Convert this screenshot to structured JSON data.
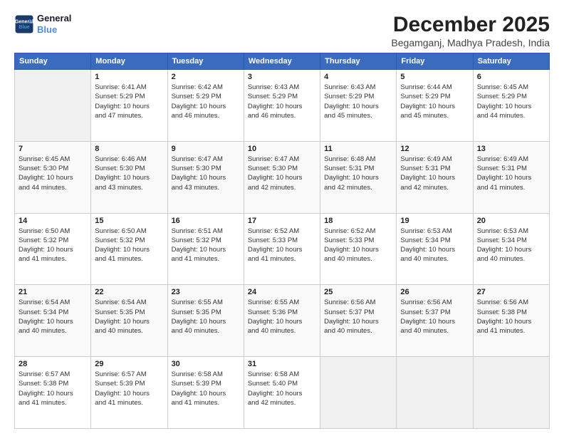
{
  "header": {
    "logo_line1": "General",
    "logo_line2": "Blue",
    "month": "December 2025",
    "location": "Begamganj, Madhya Pradesh, India"
  },
  "weekdays": [
    "Sunday",
    "Monday",
    "Tuesday",
    "Wednesday",
    "Thursday",
    "Friday",
    "Saturday"
  ],
  "weeks": [
    [
      {
        "day": "",
        "info": ""
      },
      {
        "day": "1",
        "info": "Sunrise: 6:41 AM\nSunset: 5:29 PM\nDaylight: 10 hours\nand 47 minutes."
      },
      {
        "day": "2",
        "info": "Sunrise: 6:42 AM\nSunset: 5:29 PM\nDaylight: 10 hours\nand 46 minutes."
      },
      {
        "day": "3",
        "info": "Sunrise: 6:43 AM\nSunset: 5:29 PM\nDaylight: 10 hours\nand 46 minutes."
      },
      {
        "day": "4",
        "info": "Sunrise: 6:43 AM\nSunset: 5:29 PM\nDaylight: 10 hours\nand 45 minutes."
      },
      {
        "day": "5",
        "info": "Sunrise: 6:44 AM\nSunset: 5:29 PM\nDaylight: 10 hours\nand 45 minutes."
      },
      {
        "day": "6",
        "info": "Sunrise: 6:45 AM\nSunset: 5:29 PM\nDaylight: 10 hours\nand 44 minutes."
      }
    ],
    [
      {
        "day": "7",
        "info": "Sunrise: 6:45 AM\nSunset: 5:30 PM\nDaylight: 10 hours\nand 44 minutes."
      },
      {
        "day": "8",
        "info": "Sunrise: 6:46 AM\nSunset: 5:30 PM\nDaylight: 10 hours\nand 43 minutes."
      },
      {
        "day": "9",
        "info": "Sunrise: 6:47 AM\nSunset: 5:30 PM\nDaylight: 10 hours\nand 43 minutes."
      },
      {
        "day": "10",
        "info": "Sunrise: 6:47 AM\nSunset: 5:30 PM\nDaylight: 10 hours\nand 42 minutes."
      },
      {
        "day": "11",
        "info": "Sunrise: 6:48 AM\nSunset: 5:31 PM\nDaylight: 10 hours\nand 42 minutes."
      },
      {
        "day": "12",
        "info": "Sunrise: 6:49 AM\nSunset: 5:31 PM\nDaylight: 10 hours\nand 42 minutes."
      },
      {
        "day": "13",
        "info": "Sunrise: 6:49 AM\nSunset: 5:31 PM\nDaylight: 10 hours\nand 41 minutes."
      }
    ],
    [
      {
        "day": "14",
        "info": "Sunrise: 6:50 AM\nSunset: 5:32 PM\nDaylight: 10 hours\nand 41 minutes."
      },
      {
        "day": "15",
        "info": "Sunrise: 6:50 AM\nSunset: 5:32 PM\nDaylight: 10 hours\nand 41 minutes."
      },
      {
        "day": "16",
        "info": "Sunrise: 6:51 AM\nSunset: 5:32 PM\nDaylight: 10 hours\nand 41 minutes."
      },
      {
        "day": "17",
        "info": "Sunrise: 6:52 AM\nSunset: 5:33 PM\nDaylight: 10 hours\nand 41 minutes."
      },
      {
        "day": "18",
        "info": "Sunrise: 6:52 AM\nSunset: 5:33 PM\nDaylight: 10 hours\nand 40 minutes."
      },
      {
        "day": "19",
        "info": "Sunrise: 6:53 AM\nSunset: 5:34 PM\nDaylight: 10 hours\nand 40 minutes."
      },
      {
        "day": "20",
        "info": "Sunrise: 6:53 AM\nSunset: 5:34 PM\nDaylight: 10 hours\nand 40 minutes."
      }
    ],
    [
      {
        "day": "21",
        "info": "Sunrise: 6:54 AM\nSunset: 5:34 PM\nDaylight: 10 hours\nand 40 minutes."
      },
      {
        "day": "22",
        "info": "Sunrise: 6:54 AM\nSunset: 5:35 PM\nDaylight: 10 hours\nand 40 minutes."
      },
      {
        "day": "23",
        "info": "Sunrise: 6:55 AM\nSunset: 5:35 PM\nDaylight: 10 hours\nand 40 minutes."
      },
      {
        "day": "24",
        "info": "Sunrise: 6:55 AM\nSunset: 5:36 PM\nDaylight: 10 hours\nand 40 minutes."
      },
      {
        "day": "25",
        "info": "Sunrise: 6:56 AM\nSunset: 5:37 PM\nDaylight: 10 hours\nand 40 minutes."
      },
      {
        "day": "26",
        "info": "Sunrise: 6:56 AM\nSunset: 5:37 PM\nDaylight: 10 hours\nand 40 minutes."
      },
      {
        "day": "27",
        "info": "Sunrise: 6:56 AM\nSunset: 5:38 PM\nDaylight: 10 hours\nand 41 minutes."
      }
    ],
    [
      {
        "day": "28",
        "info": "Sunrise: 6:57 AM\nSunset: 5:38 PM\nDaylight: 10 hours\nand 41 minutes."
      },
      {
        "day": "29",
        "info": "Sunrise: 6:57 AM\nSunset: 5:39 PM\nDaylight: 10 hours\nand 41 minutes."
      },
      {
        "day": "30",
        "info": "Sunrise: 6:58 AM\nSunset: 5:39 PM\nDaylight: 10 hours\nand 41 minutes."
      },
      {
        "day": "31",
        "info": "Sunrise: 6:58 AM\nSunset: 5:40 PM\nDaylight: 10 hours\nand 42 minutes."
      },
      {
        "day": "",
        "info": ""
      },
      {
        "day": "",
        "info": ""
      },
      {
        "day": "",
        "info": ""
      }
    ]
  ]
}
